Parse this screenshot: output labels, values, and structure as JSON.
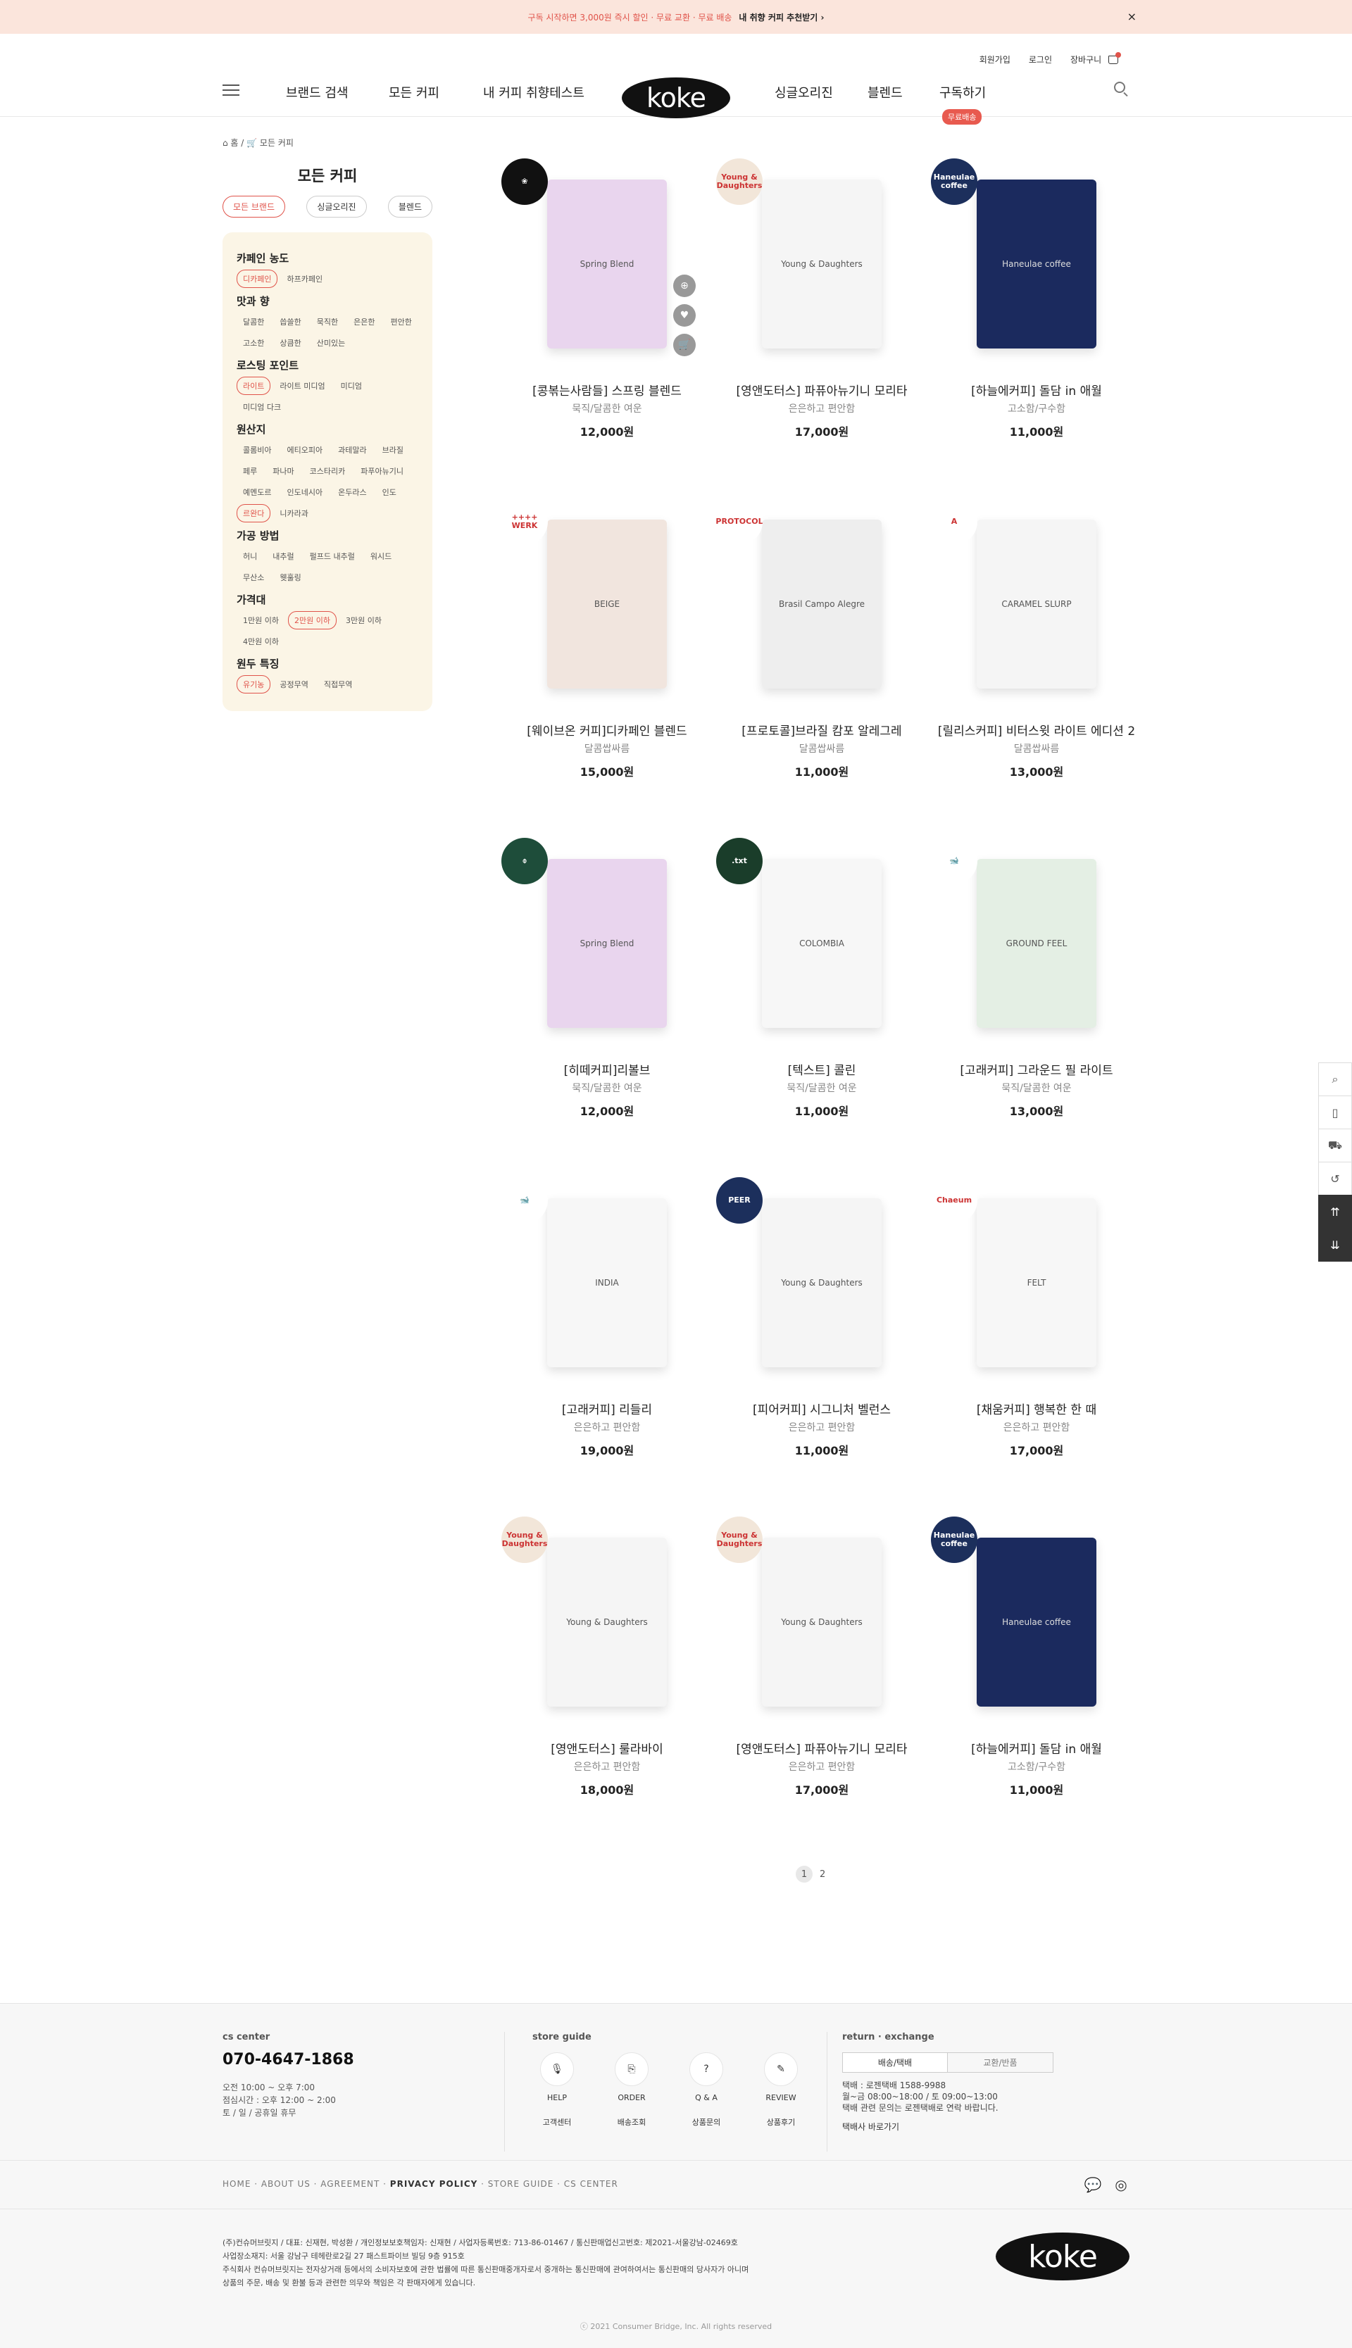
{
  "banner": {
    "text": "구독 시작하면 3,000원 즉시 할인 · 무료 교환 · 무료 배송",
    "link": "내 취향 커피 추천받기 ›",
    "close": "×"
  },
  "util": {
    "signup": "회원가입",
    "login": "로그인",
    "cart": "장바구니"
  },
  "nav": {
    "brand_search": "브랜드 검색",
    "all_coffee": "모든 커피",
    "taste_test": "내 커피 취향테스트",
    "logo": "koke",
    "single_origin": "싱글오리진",
    "blend": "블렌드",
    "subscribe": "구독하기",
    "subscribe_badge": "무료배송"
  },
  "breadcrumb": "⌂ 홈 / 🛒 모든 커피",
  "sidebar": {
    "title": "모든 커피",
    "tabs": [
      "모든 브랜드",
      "싱글오리진",
      "블렌드"
    ],
    "groups": [
      {
        "title": "카페인 농도",
        "chips": [
          "디카페인",
          "하프카페인"
        ],
        "on": [
          0
        ]
      },
      {
        "title": "맛과 향",
        "chips": [
          "달콤한",
          "씁쓸한",
          "묵직한",
          "은은한",
          "편안한",
          "고소한",
          "상큼한",
          "산미있는"
        ],
        "on": []
      },
      {
        "title": "로스팅 포인트",
        "chips": [
          "라이트",
          "라이트 미디엄",
          "미디엄",
          "미디엄 다크"
        ],
        "on": [
          0
        ]
      },
      {
        "title": "원산지",
        "chips": [
          "콜롬비아",
          "에티오피아",
          "과테말라",
          "브라질",
          "페루",
          "파나마",
          "코스타리카",
          "파푸아뉴기니",
          "예멘도르",
          "인도네시아",
          "온두라스",
          "인도",
          "르완다",
          "니카라과"
        ],
        "on": [
          12
        ]
      },
      {
        "title": "가공 방법",
        "chips": [
          "허니",
          "내추럴",
          "펄프드 내추럴",
          "워시드",
          "무산소",
          "웻훌링"
        ],
        "on": []
      },
      {
        "title": "가격대",
        "chips": [
          "1만원 이하",
          "2만원 이하",
          "3만원 이하",
          "4만원 이하"
        ],
        "on": [
          1
        ]
      },
      {
        "title": "원두 특징",
        "chips": [
          "유기농",
          "공정무역",
          "직접무역"
        ],
        "on": [
          0
        ]
      }
    ]
  },
  "products": [
    {
      "name": "[콩볶는사람들] 스프링 블렌드",
      "desc": "묵직/달콤한 여운",
      "price": "12,000원",
      "badge": "❀",
      "badge_bg": "#111111",
      "pkg_text": "Spring Blend",
      "pkg_bg": "#e9d5ee"
    },
    {
      "name": "[영앤도터스] 파퓨아뉴기니 모리타",
      "desc": "은은하고 편안함",
      "price": "17,000원",
      "badge": "Young & Daughters",
      "badge_bg": "#f2e6d9",
      "pkg_text": "Young & Daughters",
      "pkg_bg": "#f5f5f5"
    },
    {
      "name": "[하늘에커피] 돌담 in 애월",
      "desc": "고소함/구수함",
      "price": "11,000원",
      "badge": "Haneulae coffee",
      "badge_bg": "#1c2f5c",
      "pkg_text": "Haneulae coffee",
      "pkg_bg": "#1b2a5e"
    },
    {
      "name": "[웨이브온 커피]디카페인 블렌드",
      "desc": "달콤쌉싸름",
      "price": "15,000원",
      "badge": "++++ WERK",
      "badge_bg": "#ffffff",
      "pkg_text": "BEIGE",
      "pkg_bg": "#f1e5de"
    },
    {
      "name": "[프로토콜]브라질 캄포 알레그레",
      "desc": "달콤쌉싸름",
      "price": "11,000원",
      "badge": "PROTOCOL",
      "badge_bg": "#ffffff",
      "pkg_text": "Brasil Campo Alegre",
      "pkg_bg": "#eeeeee"
    },
    {
      "name": "[릴리스커피] 비터스윗 라이트 에디션 2",
      "desc": "달콤쌉싸름",
      "price": "13,000원",
      "badge": "A",
      "badge_bg": "#ffffff",
      "pkg_text": "CARAMEL SLURP",
      "pkg_bg": "#f5f5f5"
    },
    {
      "name": "[히떼커피]리볼브",
      "desc": "묵직/달콤한 여운",
      "price": "12,000원",
      "badge": "⌽",
      "badge_bg": "#1e4d3a",
      "pkg_text": "Spring Blend",
      "pkg_bg": "#e9d5ee"
    },
    {
      "name": "[텍스트] 콜린",
      "desc": "묵직/달콤한 여운",
      "price": "11,000원",
      "badge": ".txt",
      "badge_bg": "#1a3d2a",
      "pkg_text": "COLOMBIA",
      "pkg_bg": "#f7f7f7"
    },
    {
      "name": "[고래커피] 그라운드 필 라이트",
      "desc": "묵직/달콤한 여운",
      "price": "13,000원",
      "badge": "🐋",
      "badge_bg": "#ffffff",
      "pkg_text": "GROUND FEEL",
      "pkg_bg": "#e4efe4"
    },
    {
      "name": "[고래커피] 리들리",
      "desc": "은은하고 편안함",
      "price": "19,000원",
      "badge": "🐋",
      "badge_bg": "#ffffff",
      "pkg_text": "INDIA",
      "pkg_bg": "#f7f7f7"
    },
    {
      "name": "[피어커피] 시그니처 벨런스",
      "desc": "은은하고 편안함",
      "price": "11,000원",
      "badge": "PEER",
      "badge_bg": "#1c2f5c",
      "pkg_text": "Young & Daughters",
      "pkg_bg": "#f5f5f5"
    },
    {
      "name": "[채움커피] 행복한 한 때",
      "desc": "은은하고 편안함",
      "price": "17,000원",
      "badge": "Chaeum",
      "badge_bg": "#ffffff",
      "pkg_text": "FELT",
      "pkg_bg": "#f7f7f7"
    },
    {
      "name": "[영앤도터스] 룰라바이",
      "desc": "은은하고 편안함",
      "price": "18,000원",
      "badge": "Young & Daughters",
      "badge_bg": "#f2e6d9",
      "pkg_text": "Young & Daughters",
      "pkg_bg": "#f5f5f5"
    },
    {
      "name": "[영앤도터스] 파퓨아뉴기니 모리타",
      "desc": "은은하고 편안함",
      "price": "17,000원",
      "badge": "Young & Daughters",
      "badge_bg": "#f2e6d9",
      "pkg_text": "Young & Daughters",
      "pkg_bg": "#f5f5f5"
    },
    {
      "name": "[하늘에커피] 돌담 in 애월",
      "desc": "고소함/구수함",
      "price": "11,000원",
      "badge": "Haneulae coffee",
      "badge_bg": "#1c2f5c",
      "pkg_text": "Haneulae coffee",
      "pkg_bg": "#1b2a5e"
    }
  ],
  "pagination": {
    "current": "1",
    "next": "2"
  },
  "footer": {
    "cs_label": "cs center",
    "tel": "070-4647-1868",
    "hours": "오전 10:00 ~ 오후 7:00\n점심시간 : 오후 12:00 ~ 2:00\n토 / 일 / 공휴일 휴무",
    "store_guide_label": "store guide",
    "guide": [
      {
        "top": "HELP",
        "bottom": "고객센터"
      },
      {
        "top": "ORDER",
        "bottom": "배송조회"
      },
      {
        "top": "Q & A",
        "bottom": "상품문의"
      },
      {
        "top": "REVIEW",
        "bottom": "상품후기"
      }
    ],
    "return_label": "return · exchange",
    "tab_on": "배송/택배",
    "tab_off": "교환/반품",
    "return_info": "택배 : 로젠택배 1588-9988\n월~금 08:00~18:00 / 토 09:00~13:00\n택배 관련 문의는 로젠택배로 연락 바랍니다.",
    "return_link": "택배사 바로가기",
    "links_plain_1": "HOME · ABOUT US · AGREEMENT · ",
    "links_bold": "PRIVACY POLICY",
    "links_plain_2": " · STORE GUIDE · CS CENTER",
    "corp": "(주)컨슈머브릿지 / 대표: 신재현, 박성환 / 개인정보보호책임자: 신재현 / 사업자등록번호: 713-86-01467 / 통신판매업신고번호: 제2021-서울강남-02469호\n사업장소재지: 서울 강남구 테헤란로2길 27 패스트파이브 빌딩 9층 915호\n주식회사 컨슈머브릿지는 전자상거래 등에서의 소비자보호에 관한 법률에 따른 통신판매중개자로서 중개하는 통신판매에 관여하여서는 통신판매의 당사자가 아니며\n상품의 주문, 배송 및 환불 등과 관련한 의무와 책임은 각 판매자에게 있습니다.",
    "logo": "koke",
    "copyright": "ⓒ 2021 Consumer Bridge, Inc. All rights reserved"
  }
}
